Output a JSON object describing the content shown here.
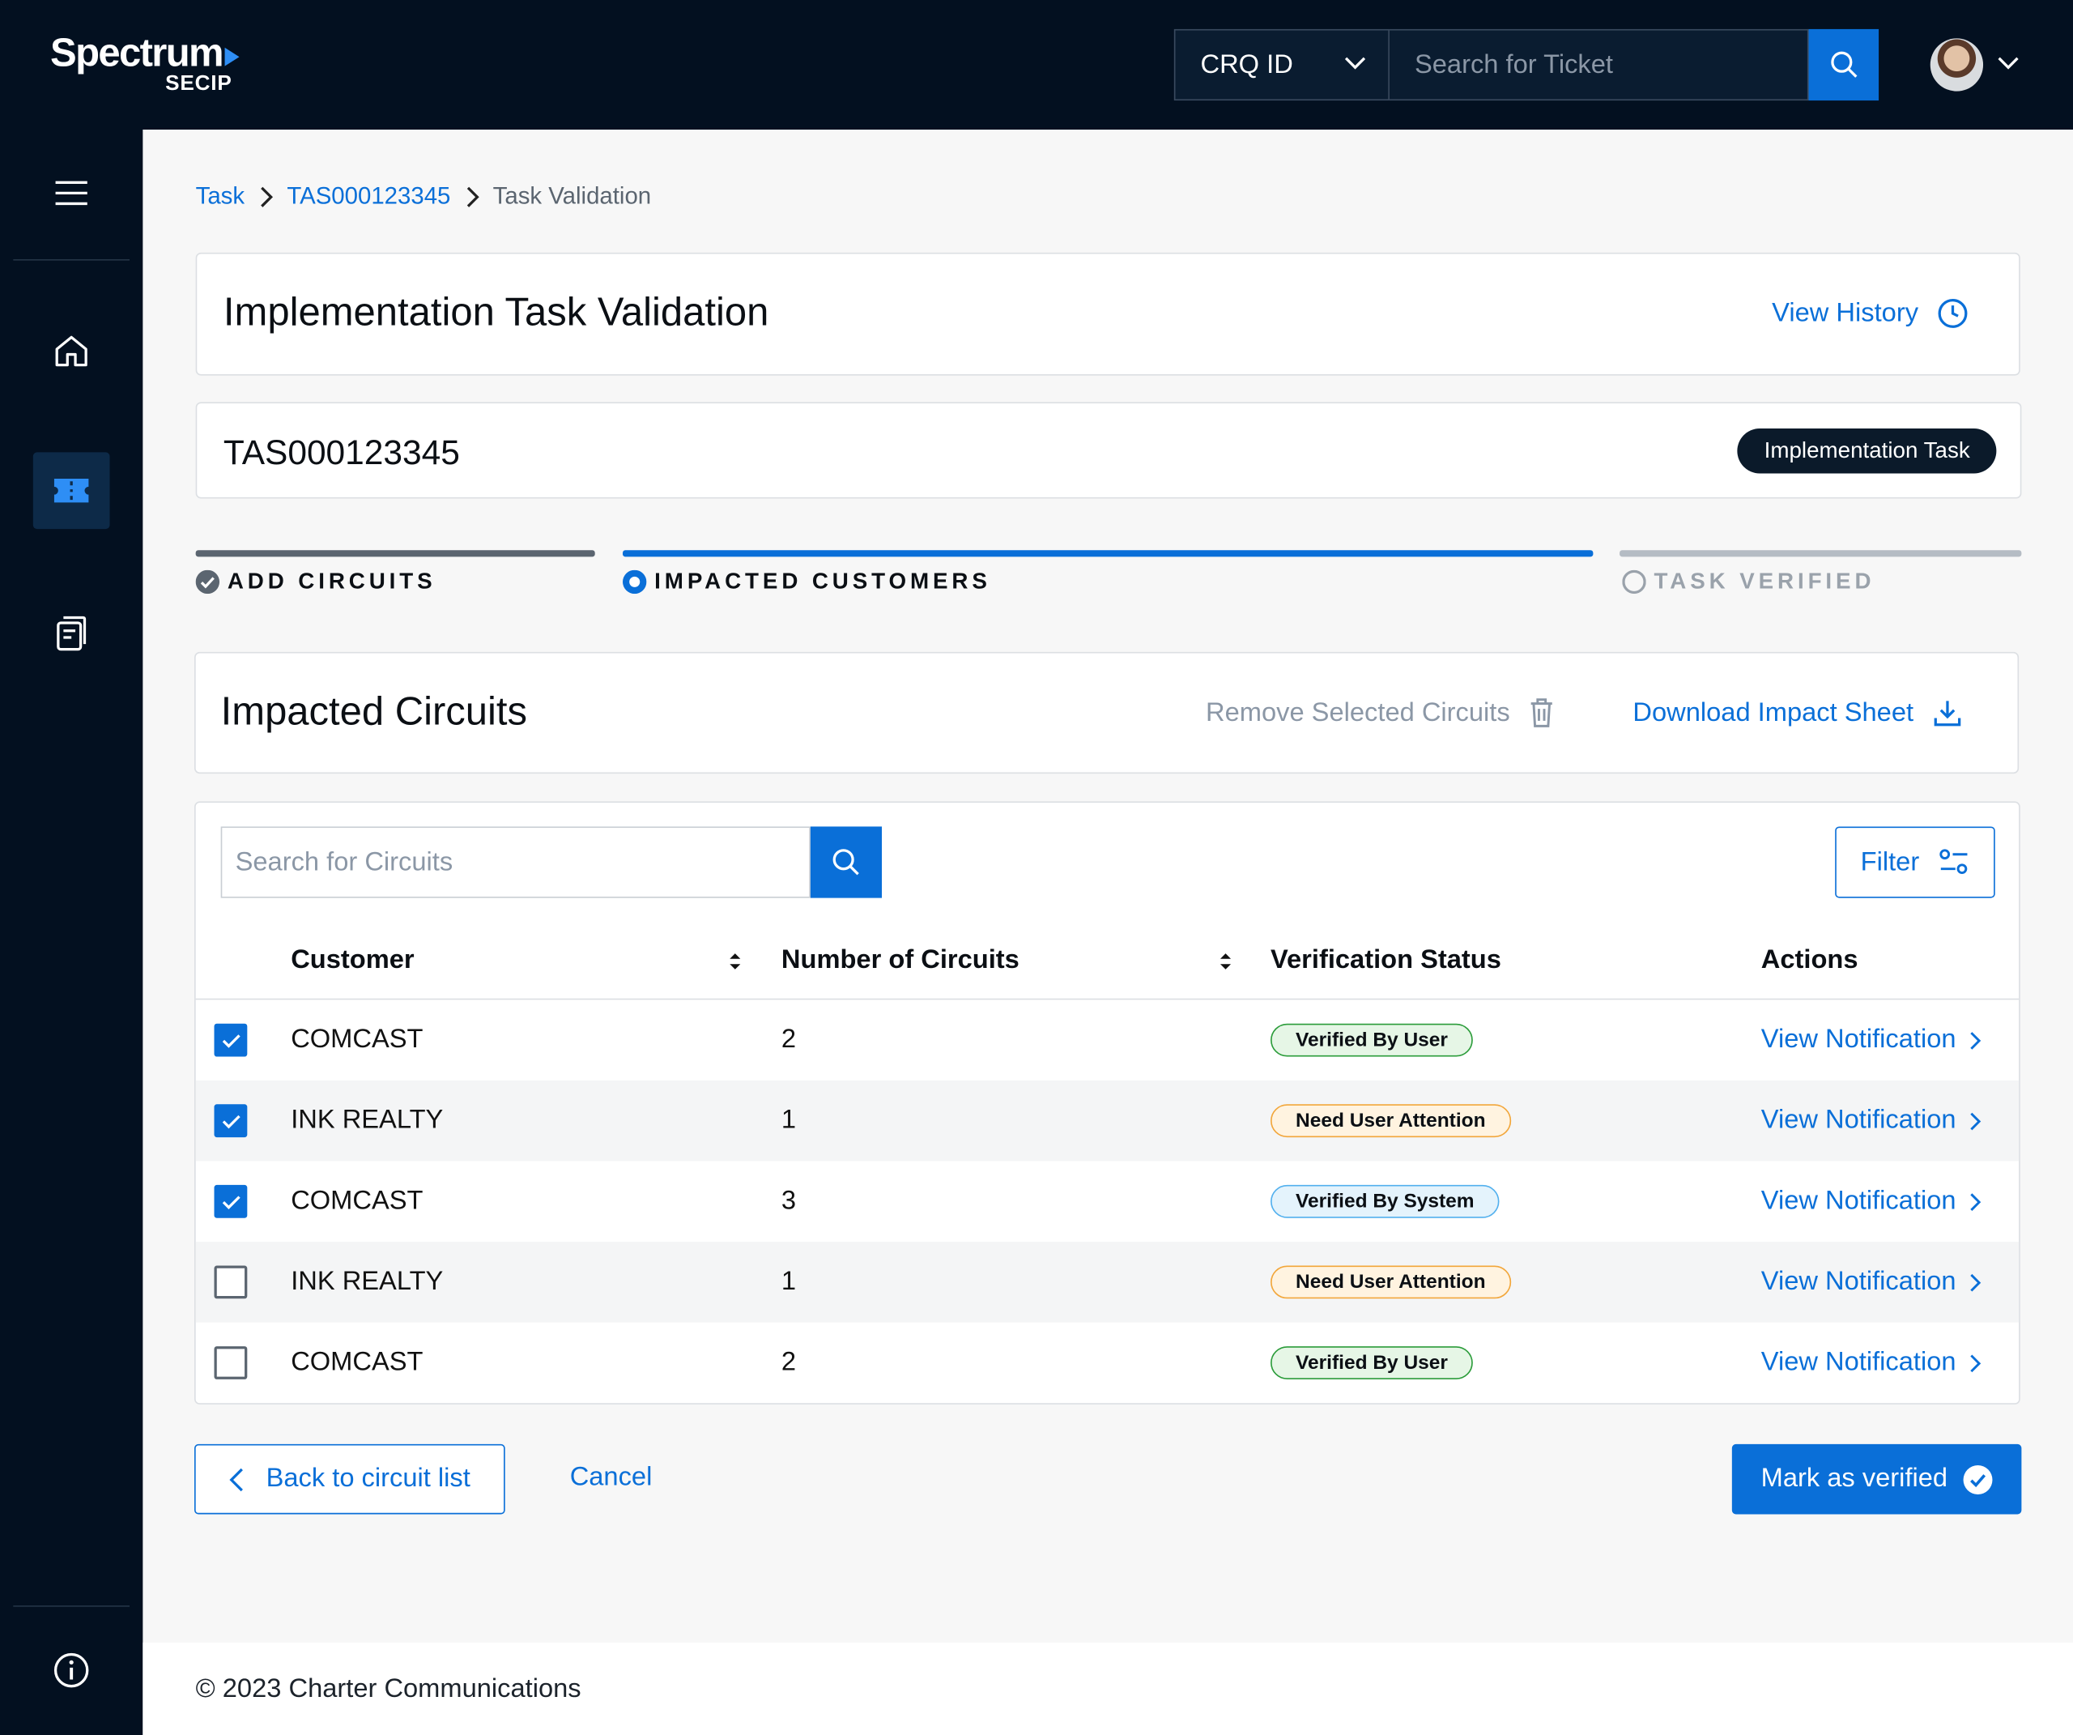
{
  "brand": {
    "name": "Spectrum",
    "product": "SECIP",
    "accent": "#0a6fd8",
    "dark": "#031020"
  },
  "header": {
    "search_type": "CRQ ID",
    "search_placeholder": "Search for Ticket",
    "search_icon": "search-icon",
    "user_menu_icon": "chevron-down-icon"
  },
  "sidebar": {
    "items": [
      {
        "icon": "hamburger-menu-icon"
      },
      {
        "icon": "home-icon"
      },
      {
        "icon": "ticket-icon",
        "active": true
      },
      {
        "icon": "documents-icon"
      },
      {
        "icon": "info-icon"
      }
    ]
  },
  "breadcrumb": {
    "items": [
      "Task",
      "TAS000123345",
      "Task Validation"
    ]
  },
  "page": {
    "title": "Implementation Task Validation",
    "history_label": "View History",
    "task_id": "TAS000123345",
    "task_type": "Implementation Task"
  },
  "stepper": {
    "steps": [
      {
        "label": "ADD CIRCUITS",
        "state": "complete"
      },
      {
        "label": "IMPACTED CUSTOMERS",
        "state": "current"
      },
      {
        "label": "TASK VERIFIED",
        "state": "pending"
      }
    ]
  },
  "impacted": {
    "title": "Impacted Circuits",
    "remove_label": "Remove Selected Circuits",
    "download_label": "Download Impact Sheet"
  },
  "table": {
    "search_placeholder": "Search for Circuits",
    "filter_label": "Filter",
    "columns": [
      "Customer",
      "Number of Circuits",
      "Verification Status",
      "Actions"
    ],
    "rows": [
      {
        "checked": true,
        "customer": "COMCAST",
        "circuits": "2",
        "status": "Verified By User",
        "status_color": "green",
        "action": "View Notification"
      },
      {
        "checked": true,
        "customer": "INK REALTY",
        "circuits": "1",
        "status": "Need User Attention",
        "status_color": "orange",
        "action": "View Notification"
      },
      {
        "checked": true,
        "customer": "COMCAST",
        "circuits": "3",
        "status": "Verified By System",
        "status_color": "blue",
        "action": "View Notification"
      },
      {
        "checked": false,
        "customer": "INK REALTY",
        "circuits": "1",
        "status": "Need User Attention",
        "status_color": "orange",
        "action": "View Notification"
      },
      {
        "checked": false,
        "customer": "COMCAST",
        "circuits": "2",
        "status": "Verified By User",
        "status_color": "green",
        "action": "View Notification"
      }
    ]
  },
  "actions": {
    "back_label": "Back to circuit list",
    "cancel_label": "Cancel",
    "verify_label": "Mark as verified"
  },
  "footer": {
    "copyright": "© 2023 Charter Communications"
  }
}
